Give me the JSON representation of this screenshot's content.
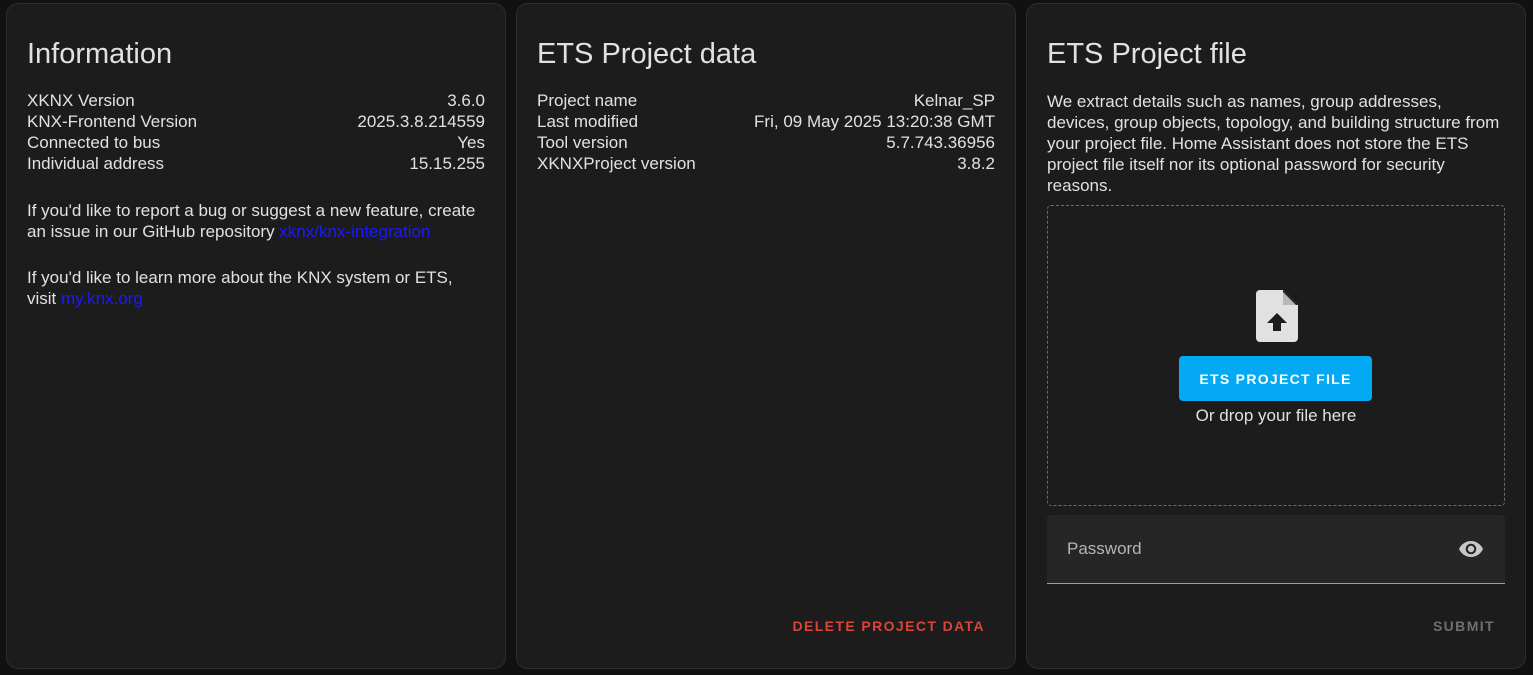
{
  "information": {
    "title": "Information",
    "rows": [
      {
        "label": "XKNX Version",
        "value": "3.6.0"
      },
      {
        "label": "KNX-Frontend Version",
        "value": "2025.3.8.214559"
      },
      {
        "label": "Connected to bus",
        "value": "Yes"
      },
      {
        "label": "Individual address",
        "value": "15.15.255"
      }
    ],
    "bug_text": "If you'd like to report a bug or suggest a new feature, create an issue in our GitHub repository ",
    "bug_link": "xknx/knx-integration",
    "learn_text": "If you'd like to learn more about the KNX system or ETS, visit ",
    "learn_link": "my.knx.org"
  },
  "project_data": {
    "title": "ETS Project data",
    "rows": [
      {
        "label": "Project name",
        "value": "Kelnar_SP"
      },
      {
        "label": "Last modified",
        "value": "Fri, 09 May 2025 13:20:38 GMT"
      },
      {
        "label": "Tool version",
        "value": "5.7.743.36956"
      },
      {
        "label": "XKNXProject version",
        "value": "3.8.2"
      }
    ],
    "delete_label": "DELETE PROJECT DATA"
  },
  "project_file": {
    "title": "ETS Project file",
    "description": "We extract details such as names, group addresses, devices, group objects, topology, and building structure from your project file. Home Assistant does not store the ETS project file itself nor its optional password for security reasons.",
    "upload_icon": "file-upload-icon",
    "upload_button": "ETS PROJECT FILE",
    "drop_hint": "Or drop your file here",
    "password_placeholder": "Password",
    "password_toggle_icon": "eye-icon",
    "submit_label": "SUBMIT"
  },
  "colors": {
    "accent": "#03a9f4",
    "danger": "#db4437",
    "link": "#1a1aff"
  }
}
